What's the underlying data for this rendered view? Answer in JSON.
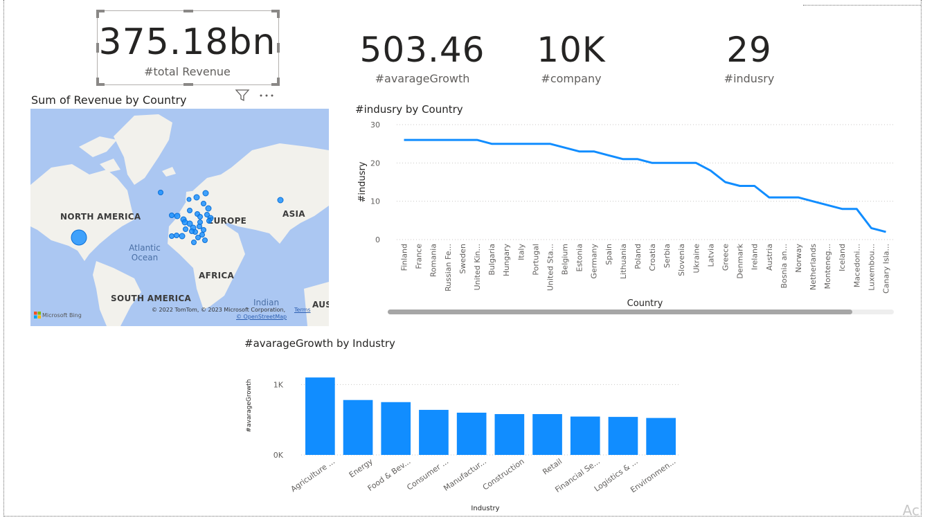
{
  "kpis": {
    "total_revenue": {
      "value": "375.18bn",
      "label": "#total Revenue"
    },
    "average_growth": {
      "value": "503.46",
      "label": "#avarageGrowth"
    },
    "company": {
      "value": "10K",
      "label": "#company"
    },
    "industry": {
      "value": "29",
      "label": "#indusry"
    }
  },
  "visual_header": {
    "filter_icon": "filter-icon",
    "more_icon": "more-options-icon"
  },
  "map": {
    "title": "Sum of Revenue by Country",
    "labels": {
      "north_america": "NORTH AMERICA",
      "europe": "EUROPE",
      "asia": "ASIA",
      "africa": "AFRICA",
      "south_america": "SOUTH AMERICA",
      "aus": "AUS",
      "atlantic": "Atlantic",
      "ocean": "Ocean",
      "indian": "Indian"
    },
    "bing": "Microsoft Bing",
    "copyright": "© 2022 TomTom, © 2023 Microsoft Corporation,",
    "terms": "Terms",
    "osm": "© OpenStreetMap",
    "bubble_color": "#118dff"
  },
  "chart_data": [
    {
      "type": "line",
      "title": "#indusry by Country",
      "xlabel": "Country",
      "ylabel": "#indusry",
      "ylim": [
        0,
        30
      ],
      "yticks": [
        0,
        10,
        20,
        30
      ],
      "color": "#118dff",
      "categories": [
        "Finland",
        "France",
        "Romania",
        "Russian Fe...",
        "Sweden",
        "United Kin...",
        "Bulgaria",
        "Hungary",
        "Italy",
        "Portugal",
        "United Sta...",
        "Belgium",
        "Estonia",
        "Germany",
        "Spain",
        "Lithuania",
        "Poland",
        "Croatia",
        "Serbia",
        "Slovenia",
        "Ukraine",
        "Latvia",
        "Greece",
        "Denmark",
        "Ireland",
        "Austria",
        "Bosnia an...",
        "Norway",
        "Netherlands",
        "Monteneg...",
        "Iceland",
        "Macedoni...",
        "Luxembou...",
        "Canary Isla..."
      ],
      "values": [
        26,
        26,
        26,
        26,
        26,
        26,
        25,
        25,
        25,
        25,
        25,
        24,
        23,
        23,
        22,
        21,
        21,
        20,
        20,
        20,
        20,
        18,
        15,
        14,
        14,
        11,
        11,
        11,
        10,
        9,
        8,
        8,
        3,
        2
      ],
      "grid": true
    },
    {
      "type": "bar",
      "title": "#avarageGrowth by Industry",
      "xlabel": "Industry",
      "ylabel": "#avarageGrowth",
      "ylim": [
        0,
        1200
      ],
      "yticks": [
        {
          "v": 0,
          "label": "0K"
        },
        {
          "v": 1000,
          "label": "1K"
        }
      ],
      "color": "#118dff",
      "categories": [
        "Agriculture ...",
        "Energy",
        "Food & Bev...",
        "Consumer ...",
        "Manufactur...",
        "Construction",
        "Retail",
        "Financial Se...",
        "Logistics & ...",
        "Environmen..."
      ],
      "values": [
        1100,
        780,
        750,
        640,
        600,
        580,
        580,
        545,
        540,
        525
      ],
      "grid": true
    }
  ],
  "watermark": "Ac"
}
